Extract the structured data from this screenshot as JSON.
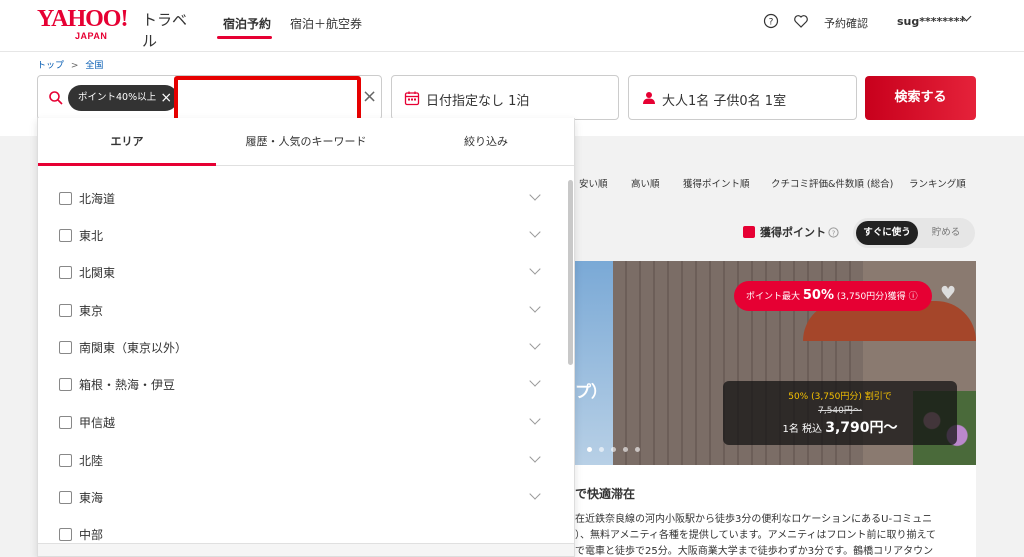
{
  "header": {
    "logo_main": "YAHOO!",
    "logo_sub": "JAPAN",
    "logo_travel": "トラベル",
    "nav": [
      "宿泊予約",
      "宿泊＋航空券"
    ],
    "reservation_label": "予約確認",
    "user_label": "sug********"
  },
  "breadcrumb": [
    "トップ",
    ">",
    "全国"
  ],
  "search": {
    "chip_label": "ポイント40%以上",
    "keyword_value": "",
    "date_label": "日付指定なし 1泊",
    "guests_label": "大人1名  子供0名  1室",
    "search_button": "検索する"
  },
  "dropdown": {
    "tabs": [
      "エリア",
      "履歴・人気のキーワード",
      "絞り込み"
    ],
    "areas": [
      "北海道",
      "東北",
      "北関東",
      "東京",
      "南関東（東京以外）",
      "箱根・熱海・伊豆",
      "甲信越",
      "北陸",
      "東海",
      "中部"
    ]
  },
  "sort": [
    "安い順",
    "高い順",
    "獲得ポイント順",
    "クチコミ評価&件数順 (総合)",
    "ランキング順"
  ],
  "points": {
    "label": "獲得ポイント",
    "use_now": "すぐに使う",
    "save": "貯める"
  },
  "listing": {
    "promo_prefix": "ポイント最大",
    "promo_percent": "50%",
    "promo_suffix": "(3,750円分)獲得",
    "photo_caption": "プ）",
    "discount_line": "50% (3,750円分) 割引で",
    "old_price": "7,540円〜",
    "price_prefix": "1名 税込",
    "price": "3,790円〜",
    "title": "で快適滞在",
    "desc": [
      "在近鉄奈良線の河内小阪駅から徒歩3分の便利なロケーションにあるU-コミュニ",
      "）、無料アメニティ各種を提供しています。アメニティはフロント前に取り揃えて",
      "で電車と徒歩で25分。大阪商業大学まで徒歩わずか3分です。鶴橋コリアタウン"
    ]
  },
  "colors": {
    "accent": "#e60033",
    "focus_border": "#e60000",
    "link": "#0a5fb4"
  }
}
